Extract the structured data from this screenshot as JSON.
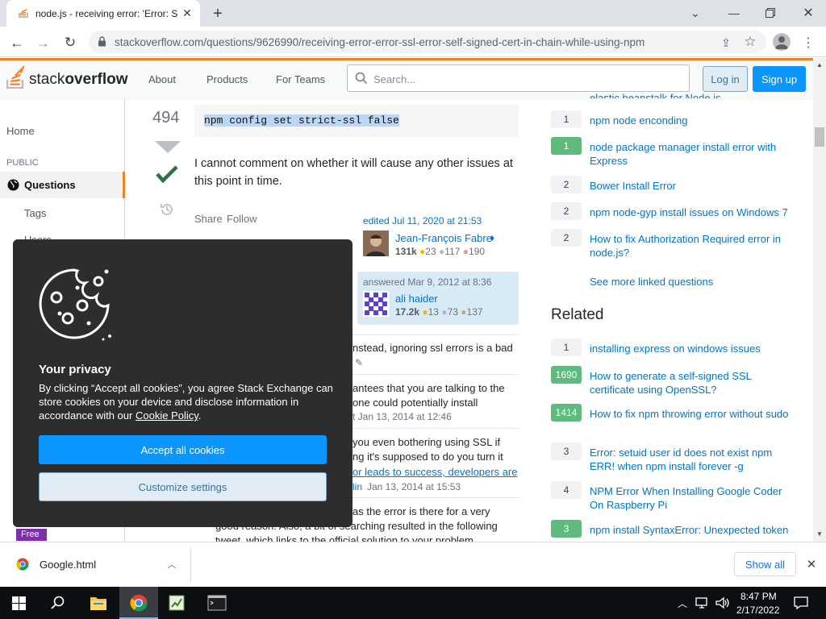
{
  "browser": {
    "tab_title": "node.js - receiving error: 'Error: S",
    "url": "stackoverflow.com/questions/9626990/receiving-error-error-ssl-error-self-signed-cert-in-chain-while-using-npm"
  },
  "so_header": {
    "logo_a": "stack",
    "logo_b": "overflow",
    "nav": [
      "About",
      "Products",
      "For Teams"
    ],
    "search_placeholder": "Search...",
    "login": "Log in",
    "signup": "Sign up"
  },
  "left_nav": {
    "home": "Home",
    "public": "PUBLIC",
    "questions": "Questions",
    "tags": "Tags",
    "users": "Users"
  },
  "answer": {
    "score": "494",
    "code": "npm config set strict-ssl false",
    "text": "I cannot comment on whether it will cause any other issues at this point in time.",
    "share": "Share",
    "follow": "Follow",
    "edited": "edited Jul 11, 2020 at 21:53",
    "editor_name": "Jean-François Fabre",
    "editor_rep": "131k",
    "editor_gold": "23",
    "editor_silver": "117",
    "editor_bronze": "190",
    "answered": "answered Mar 9, 2012 at 8:36",
    "author_name": "ali haider",
    "author_rep": "17.2k",
    "author_gold": "13",
    "author_silver": "73",
    "author_bronze": "137"
  },
  "comments": {
    "c1": "nstead, ignoring ssl errors is a bad",
    "c2a": "antees that you are talking to the",
    "c2b": "one could potentially install",
    "c2c": "t Jan 13, 2014 at 12:46",
    "c3a": "you even bothering using SSL if",
    "c3b": "ng it's supposed to do you turn it",
    "c3c": "or leads to success, developers are",
    "c3d": "lin",
    "c3e": "Jan 13, 2014 at 15:53",
    "c4a": "as the error is there for a very",
    "c4b": "good reason. Also, a bit of searching resulted in the following",
    "c4c": "tweet, which links to the official solution to your problem"
  },
  "linked": [
    {
      "count": "1",
      "title": "npm node enconding",
      "accepted": false
    },
    {
      "count": "1",
      "title": "node package manager install error with Express",
      "accepted": true
    },
    {
      "count": "2",
      "title": "Bower Install Error",
      "accepted": false
    },
    {
      "count": "2",
      "title": "npm node-gyp install issues on Windows 7",
      "accepted": false
    },
    {
      "count": "2",
      "title": "How to fix Authorization Required error in node.js?",
      "accepted": false
    }
  ],
  "see_more": "See more linked questions",
  "related_heading": "Related",
  "related": [
    {
      "count": "1",
      "title": "installing express on windows issues",
      "accepted": false
    },
    {
      "count": "1690",
      "title": "How to generate a self-signed SSL certificate using OpenSSL?",
      "accepted": true
    },
    {
      "count": "1414",
      "title": "How to fix npm throwing error without sudo",
      "accepted": true
    },
    {
      "count": "3",
      "title": "Error: setuid user id does not exist npm ERR! when npm install forever -g",
      "accepted": false
    },
    {
      "count": "4",
      "title": "NPM Error When Installing Google Coder On Raspberry Pi",
      "accepted": false
    },
    {
      "count": "3",
      "title": "npm install SyntaxError: Unexpected token",
      "accepted": true
    }
  ],
  "cookie": {
    "heading": "Your privacy",
    "text": "By clicking “Accept all cookies”, you agree Stack Exchange can store cookies on your device and disclose information in accordance with our",
    "policy_link": "Cookie Policy",
    "accept": "Accept all cookies",
    "customize": "Customize settings"
  },
  "free_badge": "Free",
  "download": {
    "file": "Google.html",
    "show_all": "Show all"
  },
  "taskbar": {
    "time": "8:47 PM",
    "date": "2/17/2022"
  }
}
